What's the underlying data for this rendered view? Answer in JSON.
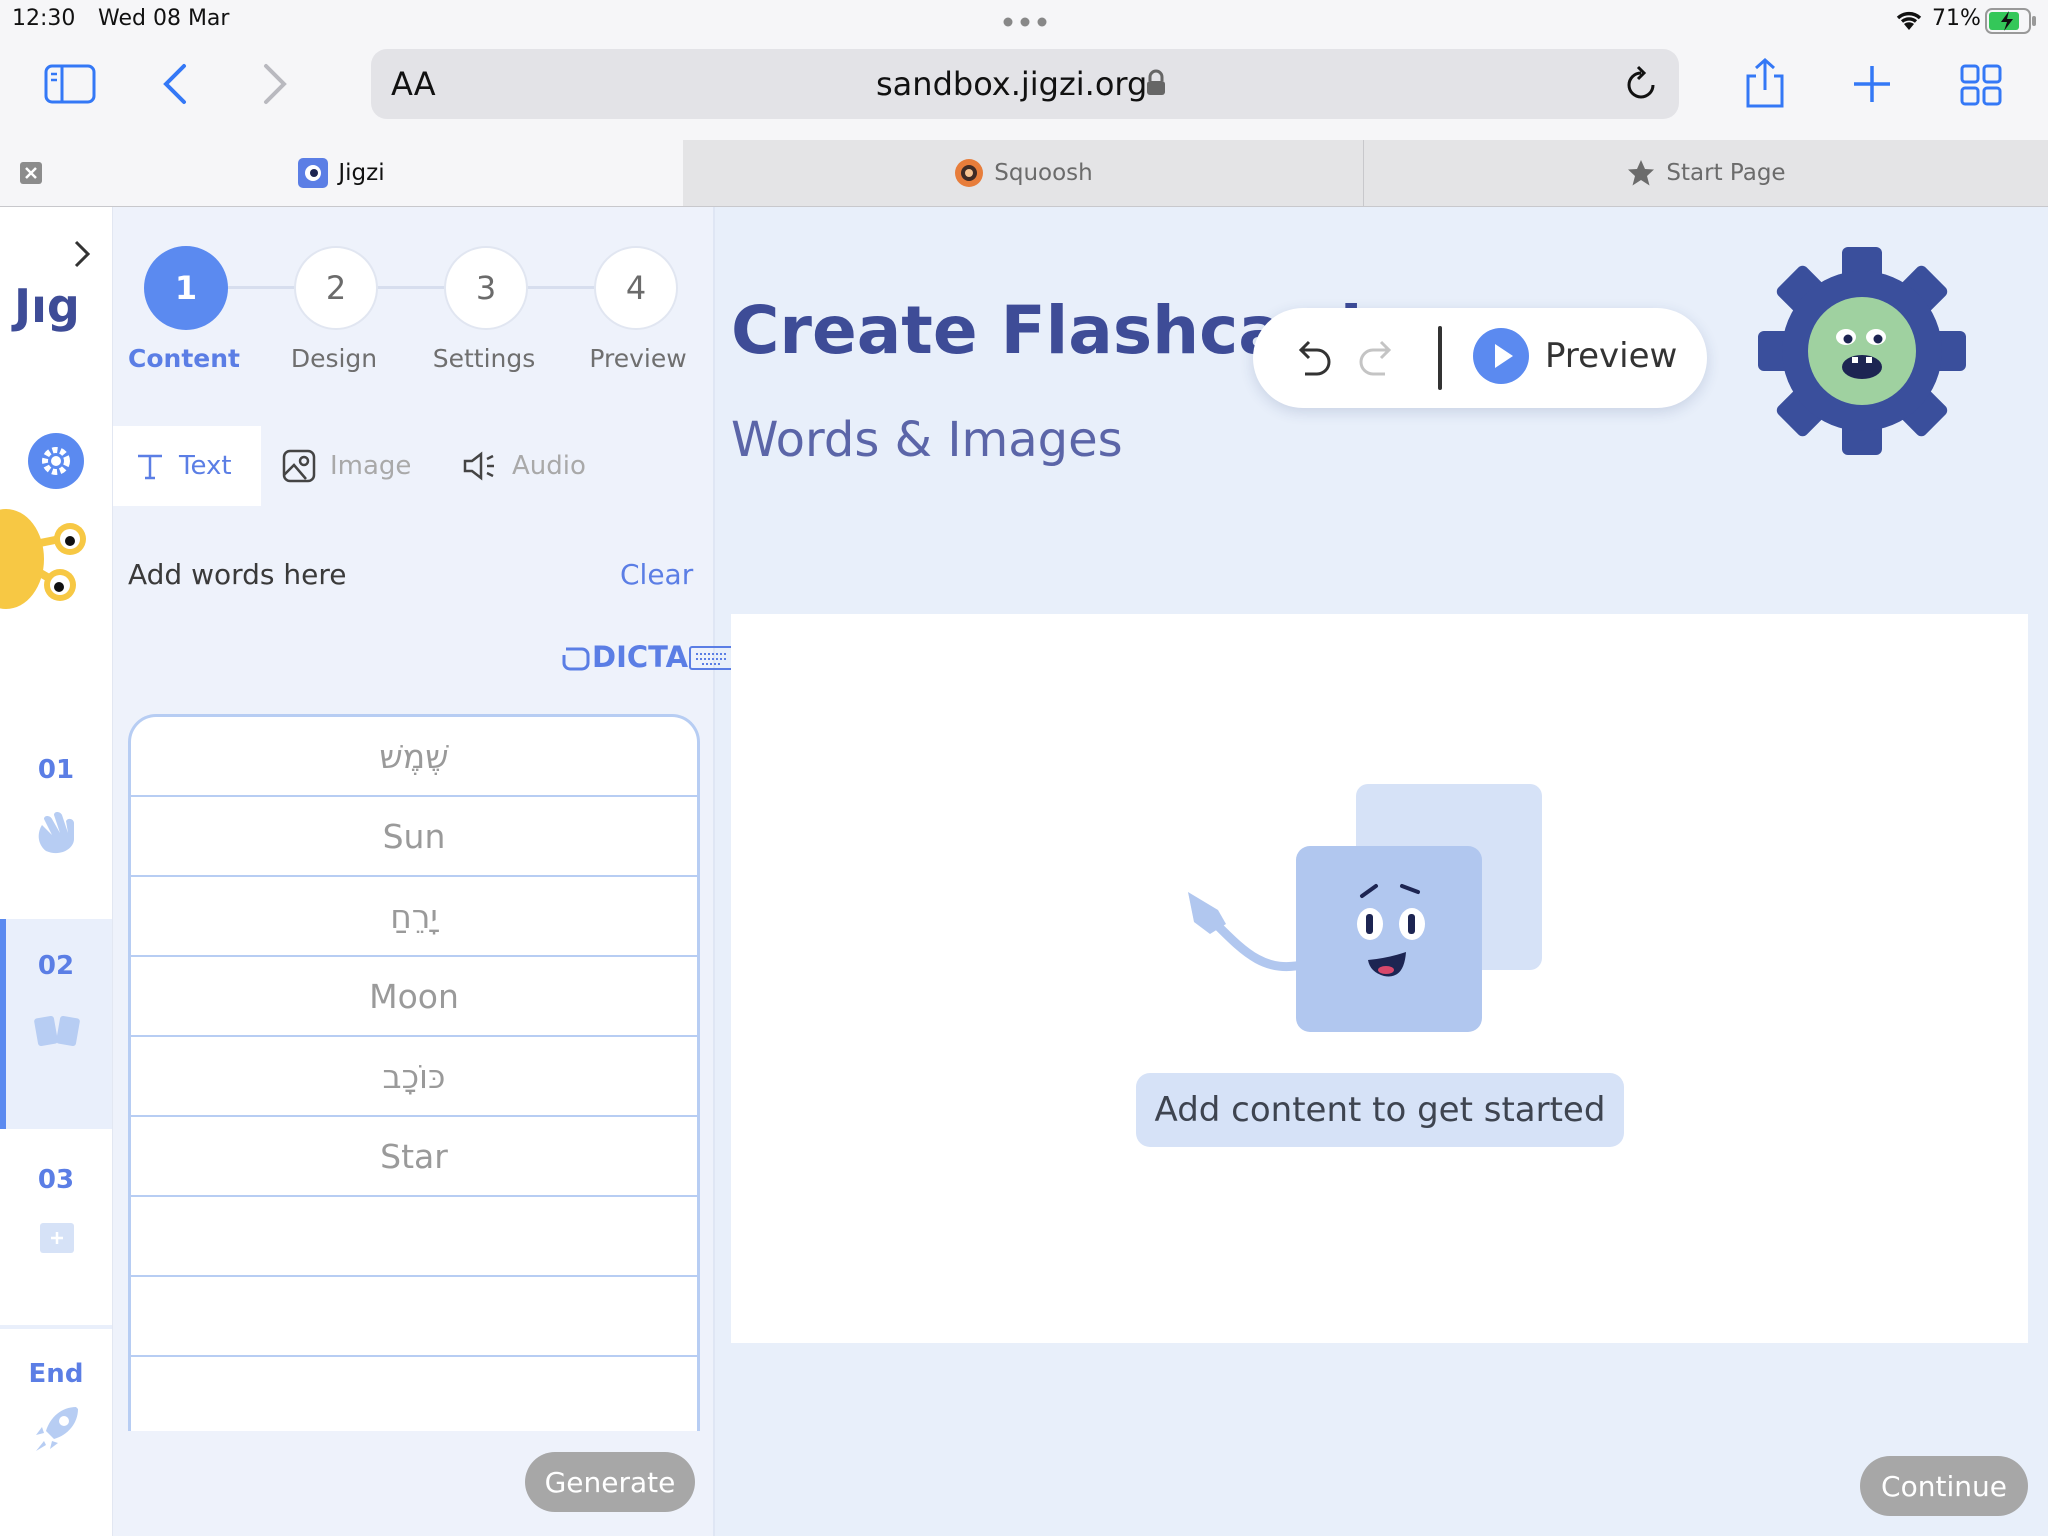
{
  "status_bar": {
    "time": "12:30",
    "date": "Wed 08 Mar",
    "battery": "71%"
  },
  "browser": {
    "url": "sandbox.jigzi.org",
    "text_size_label": "AA",
    "tabs": [
      {
        "label": "Jigzi",
        "active": true
      },
      {
        "label": "Squoosh",
        "active": false
      },
      {
        "label": "Start Page",
        "active": false
      }
    ]
  },
  "sidebar": {
    "logo": "Jıg",
    "slides": [
      {
        "number": "01",
        "icon": "wave-hand-icon"
      },
      {
        "number": "02",
        "icon": "cards-icon",
        "active": true
      },
      {
        "number": "03",
        "icon": "plus-icon"
      },
      {
        "number": "End",
        "icon": "rocket-icon"
      }
    ]
  },
  "steps": [
    {
      "number": "1",
      "label": "Content",
      "active": true
    },
    {
      "number": "2",
      "label": "Design"
    },
    {
      "number": "3",
      "label": "Settings"
    },
    {
      "number": "4",
      "label": "Preview"
    }
  ],
  "content_tabs": [
    {
      "label": "Text",
      "active": true
    },
    {
      "label": "Image"
    },
    {
      "label": "Audio"
    }
  ],
  "words_panel": {
    "prompt": "Add words here",
    "clear_label": "Clear",
    "dicta_label": "DICTA",
    "words": [
      "שֶׁמֶשׁ",
      "Sun",
      "יָרֵחַ",
      "Moon",
      "כּוֹכָב",
      "Star",
      "",
      "",
      ""
    ],
    "generate_label": "Generate"
  },
  "main": {
    "title": "Create Flashcards",
    "subtitle": "Words & Images",
    "preview_label": "Preview",
    "hint": "Add content to get started",
    "continue_label": "Continue"
  },
  "colors": {
    "accent": "#5b8af0",
    "title": "#3e4c97",
    "panel_bg": "#eef2fb",
    "main_bg": "#e8effa"
  }
}
